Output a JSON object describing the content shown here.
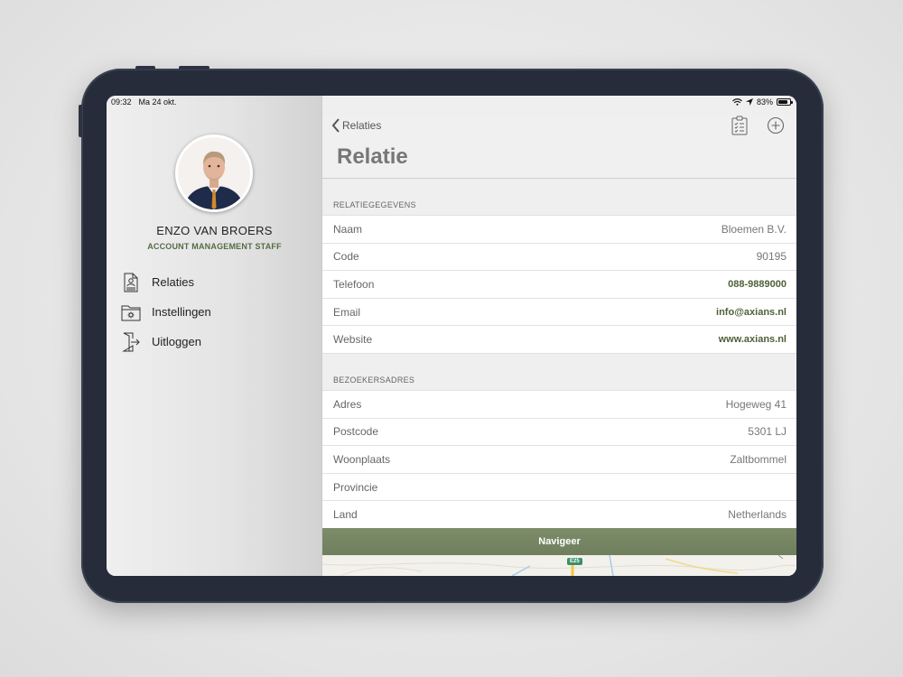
{
  "status_bar": {
    "time": "09:32",
    "date": "Ma 24 okt.",
    "battery": "83%"
  },
  "user": {
    "name": "ENZO VAN BROERS",
    "role": "ACCOUNT MANAGEMENT STAFF"
  },
  "menu": [
    {
      "label": "Relaties",
      "icon": "relaties-icon"
    },
    {
      "label": "Instellingen",
      "icon": "settings-folder-icon"
    },
    {
      "label": "Uitloggen",
      "icon": "logout-icon"
    }
  ],
  "nav": {
    "back_label": "Relaties",
    "title": "Relatie"
  },
  "sections": [
    {
      "header": "RELATIEGEGEVENS",
      "rows": [
        {
          "label": "Naam",
          "value": "Bloemen B.V."
        },
        {
          "label": "Code",
          "value": "90195"
        },
        {
          "label": "Telefoon",
          "value": "088-9889000"
        },
        {
          "label": "Email",
          "value": "info@axians.nl"
        },
        {
          "label": "Website",
          "value": "www.axians.nl"
        }
      ]
    },
    {
      "header": "BEZOEKERSADRES",
      "rows": [
        {
          "label": "Adres",
          "value": "Hogeweg 41"
        },
        {
          "label": "Postcode",
          "value": "5301 LJ"
        },
        {
          "label": "Woonplaats",
          "value": "Zaltbommel"
        },
        {
          "label": "Provincie",
          "value": ""
        },
        {
          "label": "Land",
          "value": "Netherlands"
        }
      ]
    }
  ],
  "navigate_button": "Navigeer",
  "map": {
    "road_label": "E25"
  },
  "colors": {
    "accent": "#4e6138",
    "button": "#76865f",
    "device": "#262c3a"
  }
}
